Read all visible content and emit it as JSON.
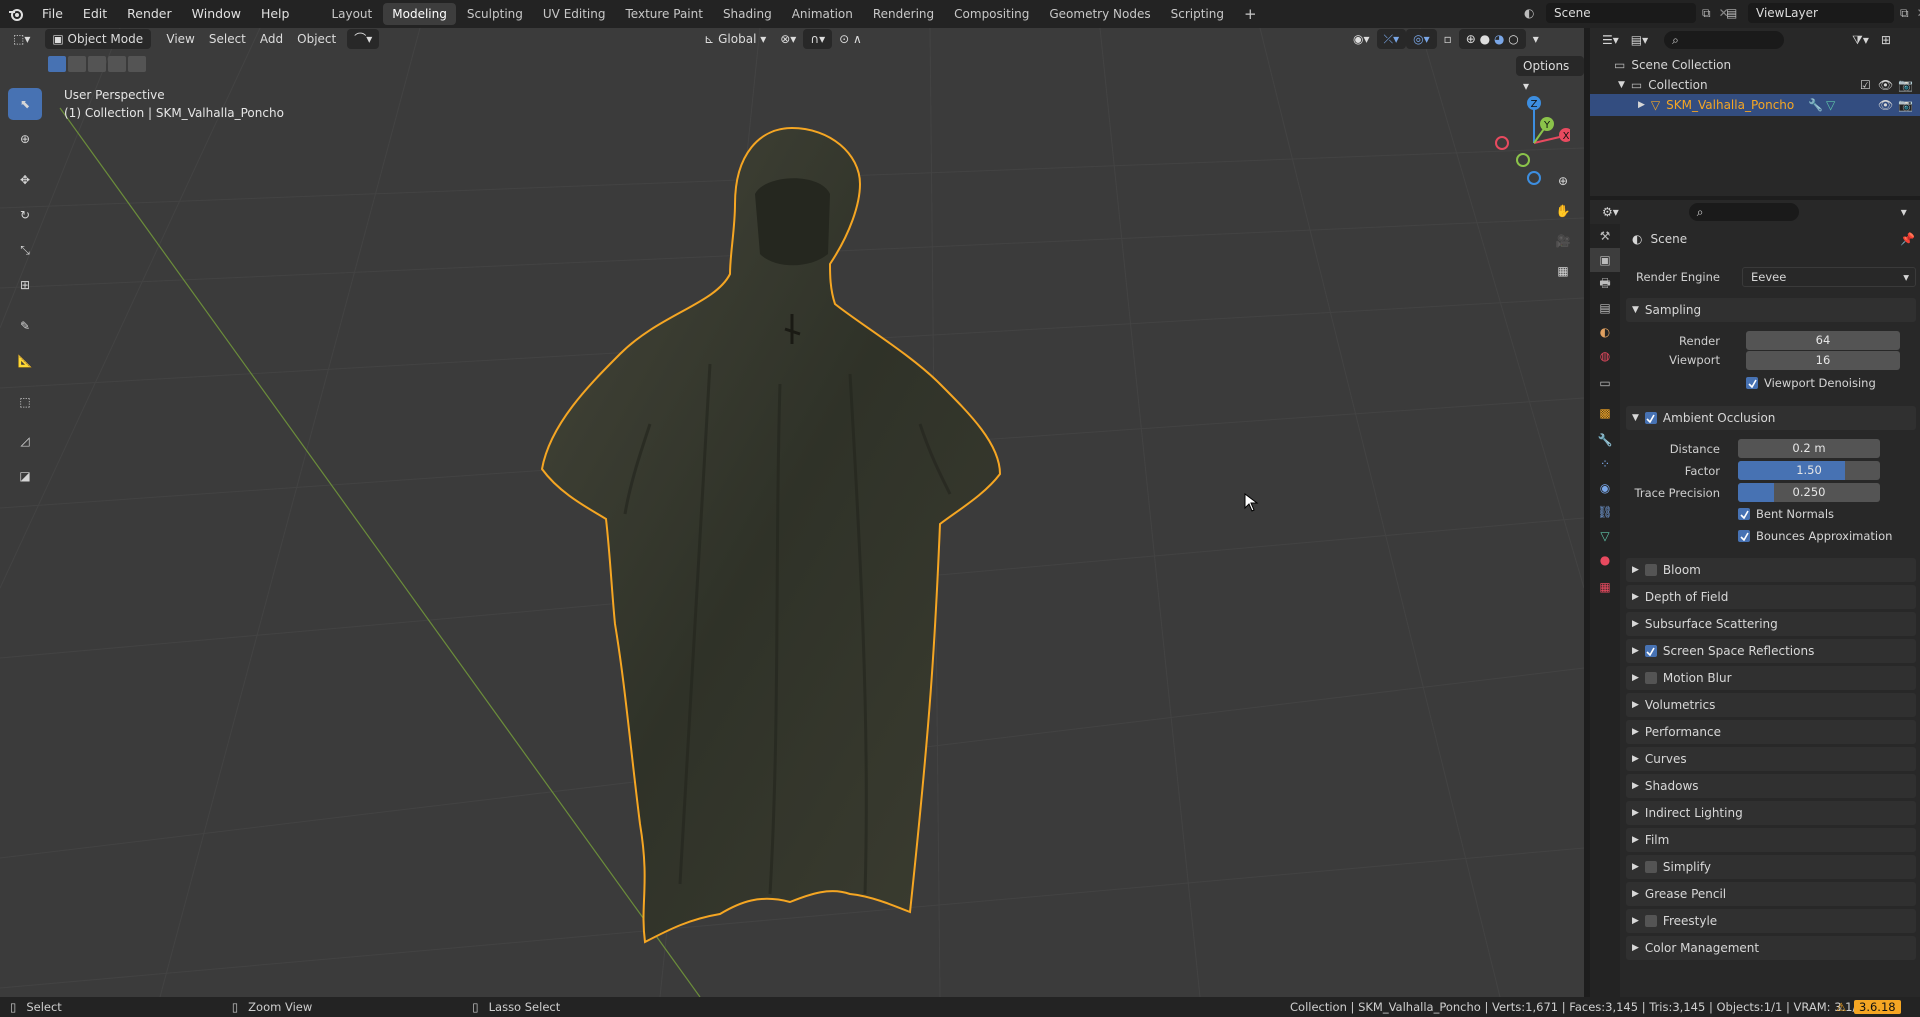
{
  "menu": [
    "File",
    "Edit",
    "Render",
    "Window",
    "Help"
  ],
  "workspaces": [
    "Layout",
    "Modeling",
    "Sculpting",
    "UV Editing",
    "Texture Paint",
    "Shading",
    "Animation",
    "Rendering",
    "Compositing",
    "Geometry Nodes",
    "Scripting"
  ],
  "active_workspace": "Modeling",
  "add_tab": "+",
  "scene_name": "Scene",
  "view_layer": "ViewLayer",
  "viewport": {
    "mode": "Object Mode",
    "menus": [
      "View",
      "Select",
      "Add",
      "Object"
    ],
    "orientation": "Global",
    "options": "Options",
    "overlay_title": "User Perspective",
    "overlay_subtitle": "(1) Collection | SKM_Valhalla_Poncho",
    "axes": {
      "x": "X",
      "y": "Y",
      "z": "Z"
    }
  },
  "outliner": {
    "root": "Scene Collection",
    "collection": "Collection",
    "object": "SKM_Valhalla_Poncho"
  },
  "properties": {
    "context": "Scene",
    "render_engine_label": "Render Engine",
    "render_engine": "Eevee",
    "sampling": {
      "title": "Sampling",
      "render_label": "Render",
      "render": "64",
      "viewport_label": "Viewport",
      "viewport": "16",
      "denoise": "Viewport Denoising"
    },
    "ao": {
      "title": "Ambient Occlusion",
      "distance_label": "Distance",
      "distance": "0.2 m",
      "factor_label": "Factor",
      "factor": "1.50",
      "factor_fill": 0.75,
      "trace_label": "Trace Precision",
      "trace": "0.250",
      "trace_fill": 0.25,
      "bent": "Bent Normals",
      "bounces": "Bounces Approximation"
    },
    "panels": [
      {
        "label": "Bloom",
        "checkbox": true,
        "checked": false
      },
      {
        "label": "Depth of Field",
        "checkbox": false
      },
      {
        "label": "Subsurface Scattering",
        "checkbox": false
      },
      {
        "label": "Screen Space Reflections",
        "checkbox": true,
        "checked": true
      },
      {
        "label": "Motion Blur",
        "checkbox": true,
        "checked": false
      },
      {
        "label": "Volumetrics",
        "checkbox": false
      },
      {
        "label": "Performance",
        "checkbox": false
      },
      {
        "label": "Curves",
        "checkbox": false
      },
      {
        "label": "Shadows",
        "checkbox": false
      },
      {
        "label": "Indirect Lighting",
        "checkbox": false
      },
      {
        "label": "Film",
        "checkbox": false
      },
      {
        "label": "Simplify",
        "checkbox": true,
        "checked": false
      },
      {
        "label": "Grease Pencil",
        "checkbox": false
      },
      {
        "label": "Freestyle",
        "checkbox": true,
        "checked": false
      },
      {
        "label": "Color Management",
        "checkbox": false
      }
    ]
  },
  "status": {
    "select": "Select",
    "zoom": "Zoom View",
    "lasso": "Lasso Select",
    "stats": "Collection | SKM_Valhalla_Poncho | Verts:1,671 | Faces:3,145 | Tris:3,145 | Objects:1/1 | VRAM: 3.1/8.0 GiB",
    "version": "3.6.18"
  },
  "colors": {
    "accent": "#4772b3",
    "selection_outline": "#f5a623",
    "x_axis": "#e84a5f",
    "y_axis": "#8bc34a",
    "z_axis": "#3d8ee0"
  }
}
